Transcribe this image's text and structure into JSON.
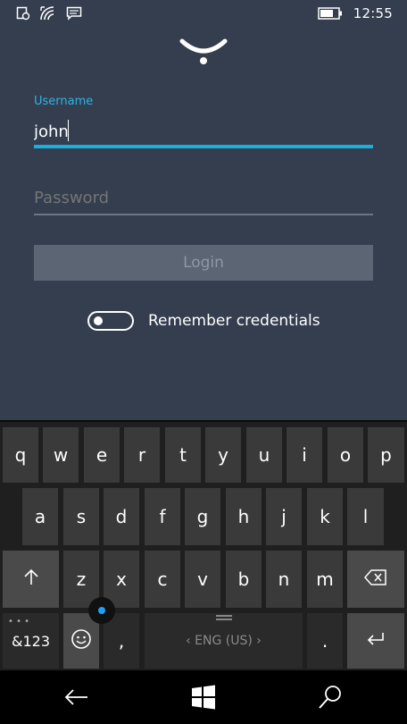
{
  "status_bar": {
    "time": "12:55",
    "icons": [
      "notification-setting-icon",
      "wifi-icon",
      "message-icon",
      "battery-icon"
    ]
  },
  "login": {
    "username_label": "Username",
    "username_value": "john",
    "password_placeholder": "Password",
    "login_label": "Login",
    "remember_label": "Remember credentials"
  },
  "keyboard": {
    "row1": [
      "q",
      "w",
      "e",
      "r",
      "t",
      "y",
      "u",
      "i",
      "o",
      "p"
    ],
    "row2": [
      "a",
      "s",
      "d",
      "f",
      "g",
      "h",
      "j",
      "k",
      "l"
    ],
    "row3": [
      "z",
      "x",
      "c",
      "v",
      "b",
      "n",
      "m"
    ],
    "numbers_label": "&123",
    "comma_label": ",",
    "period_label": ".",
    "language_label": "ENG (US)"
  },
  "colors": {
    "app_bg": "#343e4f",
    "accent": "#19b0e0",
    "keyboard_bg": "#1f1f1f"
  }
}
